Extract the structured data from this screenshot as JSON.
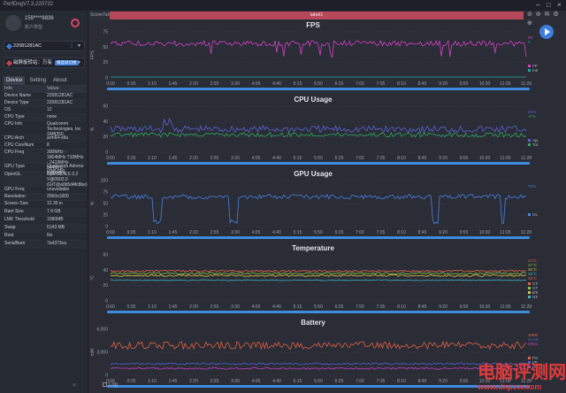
{
  "titlebar": {
    "app_name": "PerfDogV7.3.220732",
    "icons": [
      "minimize-icon",
      "maximize-icon",
      "close-icon"
    ]
  },
  "user": {
    "name": "159****8836",
    "sub": "账户类型",
    "power_icon": "power-icon"
  },
  "device_select": {
    "label": "22081281AC",
    "wifi": "wifi-icon"
  },
  "app_select": {
    "label": "磁屏旋转站：万有",
    "tag": "横竖屏切换"
  },
  "tabs": [
    "Device",
    "Setting",
    "About"
  ],
  "info": {
    "headers": [
      "Info",
      "Value"
    ],
    "rows": [
      [
        "Device Name",
        "22081281AC"
      ],
      [
        "Device Type",
        "22081281AC"
      ],
      [
        "OS",
        "12"
      ],
      [
        "CPU Type",
        "none"
      ],
      [
        "CPU Info",
        "Qualcomm Technologies, Inc SM8250"
      ],
      [
        "CPU Arch",
        "arm64-v8a"
      ],
      [
        "CPU CoreNum",
        "8"
      ],
      [
        "CPU Freq",
        "300MHz - 1804MHz 710MHz - 2419MHz 844MHz - 3187MHz"
      ],
      [
        "GPU Type",
        "Qualcomm Adreno (TM) 650"
      ],
      [
        "OpenGL",
        "OpenGL ES 3.2 V@0502.0 (GIT@a0b5d4fc8be)"
      ],
      [
        "GPU Freq",
        "unavailable"
      ],
      [
        "Resolution",
        "2560x1600"
      ],
      [
        "Screen Size",
        "12.35 in"
      ],
      [
        "Ram Size",
        "7.4 GB"
      ],
      [
        "LMK Threshold",
        "1080MB"
      ],
      [
        "Swap",
        "6143 MB"
      ],
      [
        "Root",
        "No"
      ],
      [
        "SerialNum",
        "7a4373ca"
      ]
    ]
  },
  "main": {
    "scene_tab": "SceneTab",
    "label": "label1",
    "top_icons": "⊘ ⊚ ✉ ⚙ ⊕",
    "log_label": "Log"
  },
  "x_ticks": [
    "0:00",
    "0:35",
    "1:10",
    "1:45",
    "2:20",
    "2:55",
    "3:30",
    "4:05",
    "4:40",
    "5:15",
    "5:50",
    "6:25",
    "7:00",
    "7:35",
    "8:10",
    "8:45",
    "9:20",
    "9:55",
    "10:30",
    "11:05",
    "11:28"
  ],
  "charts": [
    {
      "key": "fps",
      "title": "FPS",
      "ylabel": "FPS",
      "yticks": [
        "75",
        "50",
        "25",
        "0"
      ],
      "legend": [
        "FPS",
        "InterFrame"
      ],
      "values": [
        "59",
        "0"
      ],
      "color": "#d63fc7"
    },
    {
      "key": "cpu",
      "title": "CPU Usage",
      "ylabel": "%",
      "yticks": [
        "60",
        "40",
        "20",
        "0"
      ],
      "legend": [
        "AppCPU",
        "TotalCPU"
      ],
      "values": [
        "25%",
        "17%"
      ],
      "color": "#5b63d3"
    },
    {
      "key": "gpu",
      "title": "GPU Usage",
      "ylabel": "%",
      "yticks": [
        "100",
        "75",
        "50",
        "25",
        "0"
      ],
      "legend": [
        "GUsage"
      ],
      "values": [
        "72%"
      ],
      "color": "#4a7fe0"
    },
    {
      "key": "temp",
      "title": "Temperature",
      "ylabel": "°C",
      "yticks": [
        "60",
        "40",
        "20",
        "0"
      ],
      "legend": [
        "CTemp",
        "GTemp",
        "BTemp",
        "NTemp"
      ],
      "values": [
        "44°C",
        "47°C",
        "45°C",
        "38°C",
        "36°C"
      ],
      "color": "#e0a030"
    },
    {
      "key": "battery",
      "title": "Battery",
      "ylabel": "mW",
      "yticks": [
        "6,000",
        "3,000",
        "0"
      ],
      "legend": [
        "Power",
        "I/Power",
        "Current"
      ],
      "values": [
        "4086mW",
        "41.59mW",
        "805mA"
      ],
      "color": "#e06040"
    }
  ],
  "watermark": {
    "text": "电脑评测网",
    "url": "www.dnpcw.com"
  }
}
